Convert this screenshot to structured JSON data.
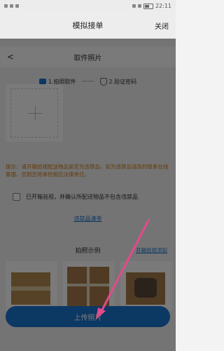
{
  "status": {
    "time": "22:11"
  },
  "outer_nav": {
    "title": "模拟接单",
    "close_label": "关闭"
  },
  "inner_nav": {
    "back_symbol": "<",
    "title": "取件照片"
  },
  "steps": [
    {
      "label": "1.拍照取件",
      "icon": "camera-icon"
    },
    {
      "separator": "——"
    },
    {
      "label": "2.验证密码",
      "icon": "shield-icon"
    }
  ],
  "upload_area": {
    "icon": "plus-icon"
  },
  "warning_text": "提示：请开箱验视配送物品是否为违禁品，如为违禁品请及时联系在线客服，否则您将承担相应法律责任。",
  "checkbox": {
    "label": "已开箱验视，并确认所配送物品不包含违禁品",
    "checked": false
  },
  "contraband_link": "违禁品清单",
  "examples": {
    "title": "拍照示例",
    "requirements_link": "开箱验视须知"
  },
  "upload_button": "上传照片",
  "colors": {
    "accent": "#1a76d2",
    "warning": "#d07a10",
    "arrow": "#e24a8a"
  }
}
